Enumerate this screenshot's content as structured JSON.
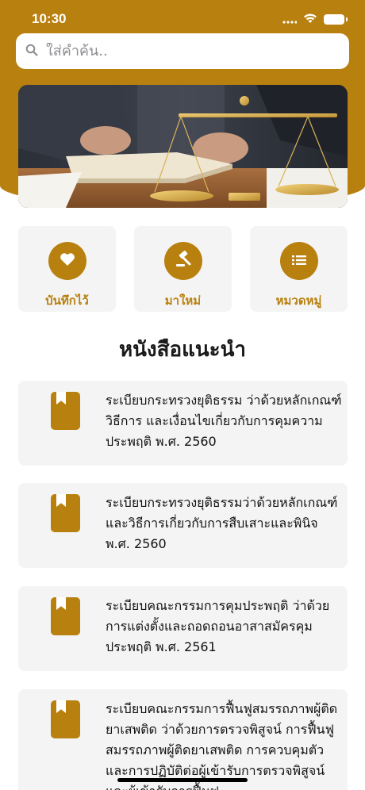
{
  "status_bar": {
    "time": "10:30"
  },
  "search": {
    "placeholder": "ใส่คำค้น.."
  },
  "quick_actions": [
    {
      "label": "บันทึกไว้",
      "icon": "heart-icon"
    },
    {
      "label": "มาใหม่",
      "icon": "gavel-icon"
    },
    {
      "label": "หมวดหมู่",
      "icon": "list-icon"
    }
  ],
  "section": {
    "title": "หนังสือแนะนำ"
  },
  "books": [
    {
      "title": "ระเบียบกระทรวงยุติธรรม ว่าด้วยหลักเกณฑ์ วิธีการ และเงื่อนไขเกี่ยวกับการคุมความประพฤติ พ.ศ. 2560"
    },
    {
      "title": "ระเบียบกระทรวงยุติธรรมว่าด้วยหลักเกณฑ์และวิธีการเกี่ยวกับการสืบเสาะและพินิจ พ.ศ. 2560"
    },
    {
      "title": "ระเบียบคณะกรรมการคุมประพฤติ ว่าด้วยการแต่งตั้งและถอดถอนอาสาสมัครคุมประพฤติ พ.ศ. 2561"
    },
    {
      "title": "ระเบียบคณะกรรมการฟื้นฟูสมรรถภาพผู้ติดยาเสพติด ว่าด้วยการตรวจพิสูจน์ การฟื้นฟูสมรรถภาพผู้ติดยาเสพติด การควบคุมตัว และการปฏิบัติต่อผู้เข้ารับการตรวจพิสูจน์ และผู้เข้ารับการฟื้นฟู"
    }
  ],
  "colors": {
    "brand": "#b8800f",
    "card": "#f4f4f4"
  }
}
